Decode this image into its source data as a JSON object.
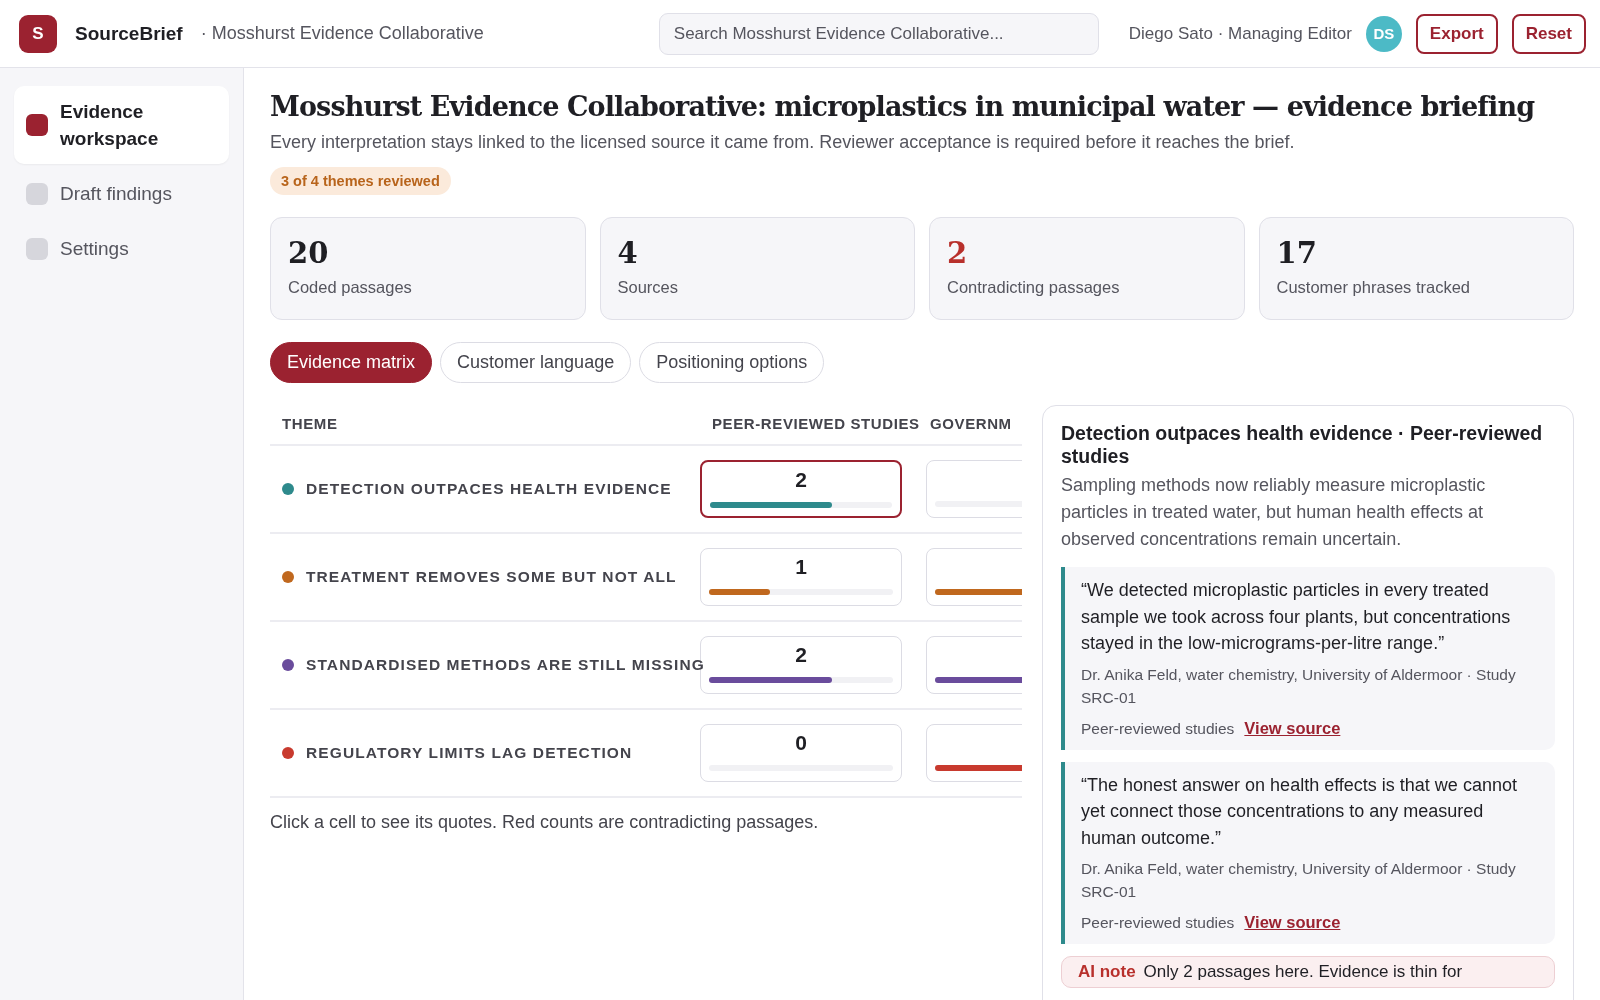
{
  "app": {
    "logo_letter": "S",
    "name": "SourceBrief",
    "workspace": "· Mosshurst Evidence Collaborative"
  },
  "search": {
    "placeholder": "Search Mosshurst Evidence Collaborative..."
  },
  "user": {
    "label": "Diego Sato · Managing Editor",
    "initials": "DS"
  },
  "actions": [
    "Export",
    "Reset"
  ],
  "sidebar": {
    "items": [
      {
        "label": "Evidence workspace",
        "selected": true
      },
      {
        "label": "Draft findings",
        "selected": false
      },
      {
        "label": "Settings",
        "selected": false
      }
    ]
  },
  "page": {
    "title": "Mosshurst Evidence Collaborative: microplastics in municipal water — evidence briefing",
    "subtitle": "Every interpretation stays linked to the licensed source it came from. Reviewer acceptance is required before it reaches the brief.",
    "badge": "3 of 4 themes reviewed"
  },
  "stats": [
    {
      "value": "20",
      "label": "Coded passages",
      "alert": false
    },
    {
      "value": "4",
      "label": "Sources",
      "alert": false
    },
    {
      "value": "2",
      "label": "Contradicting passages",
      "alert": true
    },
    {
      "value": "17",
      "label": "Customer phrases tracked",
      "alert": false
    }
  ],
  "tabs": [
    {
      "label": "Evidence matrix",
      "selected": true
    },
    {
      "label": "Customer language",
      "selected": false
    },
    {
      "label": "Positioning options",
      "selected": false
    }
  ],
  "matrix": {
    "columns": [
      "THEME",
      "PEER-REVIEWED STUDIES",
      "GOVERNM"
    ],
    "rows": [
      {
        "theme": "DETECTION OUTPACES HEALTH EVIDENCE",
        "color": "#2e8a8c",
        "cells": [
          {
            "count": "2",
            "level": 0.67,
            "selected": true
          },
          {
            "level": 0,
            "selected": false
          }
        ]
      },
      {
        "theme": "TREATMENT REMOVES SOME BUT NOT ALL",
        "color": "#c0681e",
        "cells": [
          {
            "count": "1",
            "level": 0.33,
            "selected": false
          },
          {
            "level": 0.5,
            "selected": false
          }
        ]
      },
      {
        "theme": "STANDARDISED METHODS ARE STILL MISSING",
        "color": "#6a4c9c",
        "cells": [
          {
            "count": "2",
            "level": 0.67,
            "selected": false
          },
          {
            "level": 0.5,
            "selected": false
          }
        ]
      },
      {
        "theme": "REGULATORY LIMITS LAG DETECTION",
        "color": "#c83a2e",
        "cells": [
          {
            "count": "0",
            "level": 0,
            "selected": false
          },
          {
            "level": 0.5,
            "selected": false
          }
        ]
      }
    ],
    "hint": "Click a cell to see its quotes. Red counts are contradicting passages."
  },
  "detail": {
    "title": "Detection outpaces health evidence · Peer-reviewed studies",
    "summary": "Sampling methods now reliably measure microplastic particles in treated water, but human health effects at observed concentrations remain uncertain.",
    "quotes": [
      {
        "text": "“We detected microplastic particles in every treated sample we took across four plants, but concentrations stayed in the low-micrograms-per-litre range.”",
        "attribution": "Dr. Anika Feld, water chemistry, University of Aldermoor · Study SRC-01",
        "source_type": "Peer-reviewed studies",
        "link": "View source"
      },
      {
        "text": "“The honest answer on health effects is that we cannot yet connect those concentrations to any measured human outcome.”",
        "attribution": "Dr. Anika Feld, water chemistry, University of Aldermoor · Study SRC-01",
        "source_type": "Peer-reviewed studies",
        "link": "View source"
      }
    ],
    "note": {
      "label": "AI note",
      "text": "Only 2 passages here. Evidence is thin for"
    }
  }
}
